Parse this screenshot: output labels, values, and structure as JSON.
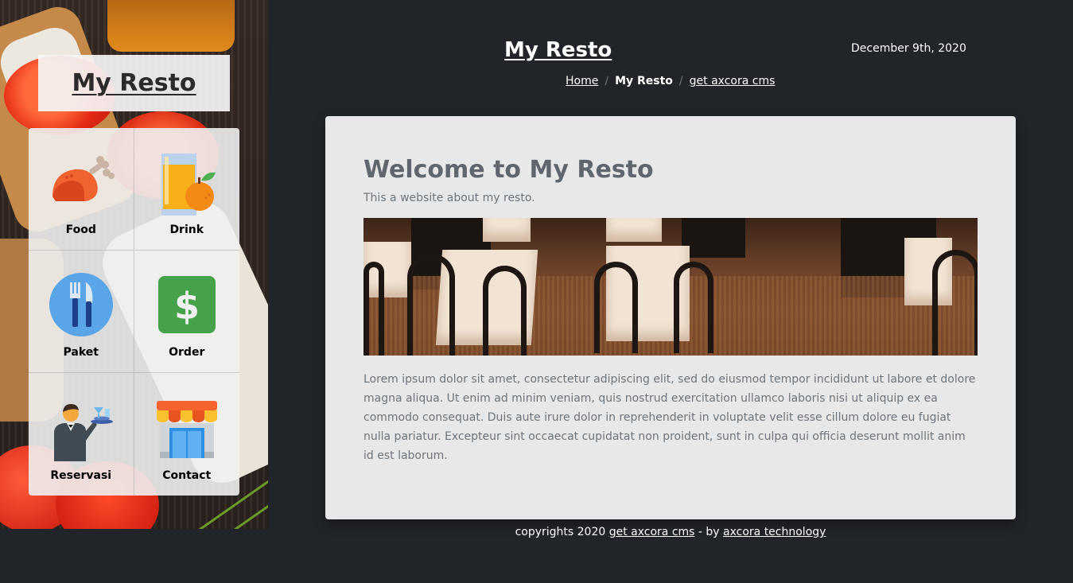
{
  "sidebar": {
    "brand": "My Resto",
    "menu": [
      {
        "label": "Food",
        "icon": "chicken-leg-icon"
      },
      {
        "label": "Drink",
        "icon": "juice-glass-icon"
      },
      {
        "label": "Paket",
        "icon": "fork-knife-icon"
      },
      {
        "label": "Order",
        "icon": "dollar-icon"
      },
      {
        "label": "Reservasi",
        "icon": "waiter-icon"
      },
      {
        "label": "Contact",
        "icon": "storefront-icon"
      }
    ]
  },
  "header": {
    "title": "My Resto",
    "date": "December 9th, 2020",
    "breadcrumb": [
      {
        "label": "Home",
        "link": true
      },
      {
        "label": "My Resto",
        "link": false
      },
      {
        "label": "get axcora cms",
        "link": true
      }
    ],
    "separator": "/"
  },
  "main": {
    "heading": "Welcome to My Resto",
    "subtitle": "This a website about my resto.",
    "image_alt": "restaurant dining room",
    "body": "Lorem ipsum dolor sit amet, consectetur adipiscing elit, sed do eiusmod tempor incididunt ut labore et dolore magna aliqua. Ut enim ad minim veniam, quis nostrud exercitation ullamco laboris nisi ut aliquip ex ea commodo consequat. Duis aute irure dolor in reprehenderit in voluptate velit esse cillum dolore eu fugiat nulla pariatur. Excepteur sint occaecat cupidatat non proident, sunt in culpa qui officia deserunt mollit anim id est laborum."
  },
  "footer": {
    "prefix": "copyrights 2020 ",
    "link1": "get axcora cms",
    "middle": " - by ",
    "link2": "axcora technology"
  },
  "colors": {
    "page_bg": "#212429",
    "card_bg": "#e8e8e8",
    "heading": "#5f666d",
    "muted_text": "#6c757d"
  }
}
